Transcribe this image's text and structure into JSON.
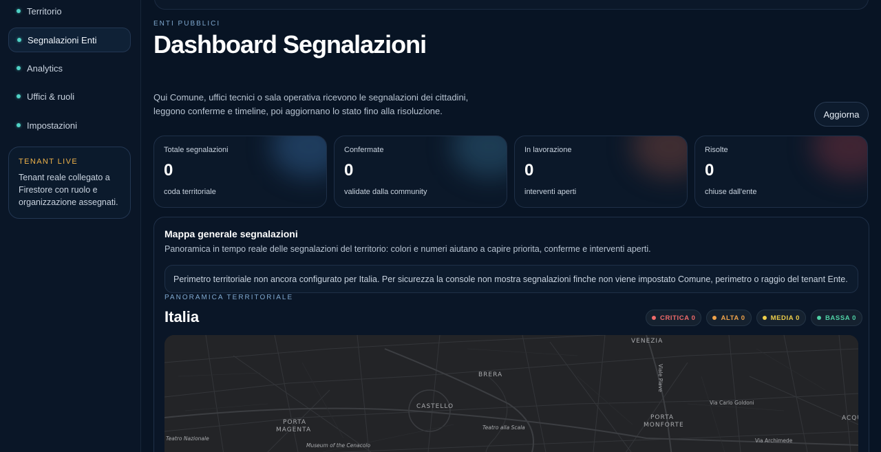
{
  "sidebar": {
    "items": [
      {
        "label": "Territorio",
        "active": false
      },
      {
        "label": "Segnalazioni Enti",
        "active": true
      },
      {
        "label": "Analytics",
        "active": false
      },
      {
        "label": "Uffici & ruoli",
        "active": false
      },
      {
        "label": "Impostazioni",
        "active": false
      }
    ],
    "tenant": {
      "label": "TENANT LIVE",
      "text": "Tenant reale collegato a Firestore con ruolo e organizzazione assegnati."
    }
  },
  "header": {
    "kicker": "ENTI PUBBLICI",
    "title": "Dashboard Segnalazioni",
    "description": "Qui Comune, uffici tecnici o sala operativa ricevono le segnalazioni dei cittadini, leggono conferme e timeline, poi aggiornano lo stato fino alla risoluzione.",
    "refresh_label": "Aggiorna"
  },
  "kpis": [
    {
      "label": "Totale segnalazioni",
      "value": "0",
      "sub": "coda territoriale",
      "glow": "#2f5b8a"
    },
    {
      "label": "Confermate",
      "value": "0",
      "sub": "validate dalla community",
      "glow": "#2c5a78"
    },
    {
      "label": "In lavorazione",
      "value": "0",
      "sub": "interventi aperti",
      "glow": "#6a3f3a"
    },
    {
      "label": "Risolte",
      "value": "0",
      "sub": "chiuse dall'ente",
      "glow": "#6b2f3c"
    }
  ],
  "map_section": {
    "title": "Mappa generale segnalazioni",
    "description": "Panoramica in tempo reale delle segnalazioni del territorio: colori e numeri aiutano a capire priorita, conferme e interventi aperti.",
    "notice": "Perimetro territoriale non ancora configurato per Italia. Per sicurezza la console non mostra segnalazioni finche non viene impostato Comune, perimetro o raggio del tenant Ente.",
    "kicker": "PANORAMICA TERRITORIALE",
    "region": "Italia",
    "legend": [
      {
        "label": "CRITICA 0",
        "color": "#f06a6a"
      },
      {
        "label": "ALTA 0",
        "color": "#f0a34a"
      },
      {
        "label": "MEDIA 0",
        "color": "#f0d04a"
      },
      {
        "label": "BASSA 0",
        "color": "#4fd1a5"
      }
    ],
    "map_labels": {
      "venezia": "VENEZIA",
      "brera": "BRERA",
      "castello": "CASTELLO",
      "porta_magenta": "PORTA",
      "porta_magenta2": "MAGENTA",
      "porta_monforte": "PORTA",
      "porta_monforte2": "MONFORTE",
      "teatro_nazionale": "Teatro Nazionale",
      "cenacolo": "Museum of the Cenacolo",
      "scala": "Teatro alla Scala",
      "viale_piave": "Viale Piave",
      "goldoni": "Via Carlo Goldoni",
      "acquabella": "ACQUA",
      "archimede": "Via Archimede"
    }
  }
}
